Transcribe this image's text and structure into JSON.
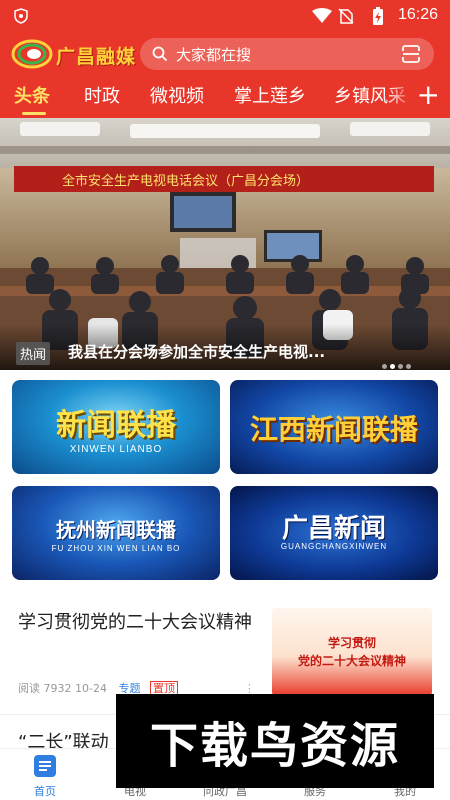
{
  "status_bar": {
    "time": "16:26"
  },
  "header": {
    "logo_text": "广昌融媒",
    "search_placeholder": "大家都在搜"
  },
  "tabs": [
    {
      "label": "头条",
      "active": true
    },
    {
      "label": "时政",
      "active": false
    },
    {
      "label": "微视频",
      "active": false
    },
    {
      "label": "掌上莲乡",
      "active": false
    },
    {
      "label": "乡镇风采",
      "active": false
    }
  ],
  "hero": {
    "banner_text": "全市安全生产电视电话会议（广昌分会场）",
    "tag": "热闻",
    "caption": "我县在分会场参加全市安全生产电视...",
    "slide_count": 4,
    "active_slide": 1
  },
  "cards": [
    {
      "title": "新闻联播",
      "subtitle": "XINWEN LIANBO"
    },
    {
      "title": "江西新闻联播",
      "subtitle": ""
    },
    {
      "title": "抚州新闻联播",
      "subtitle": "FU ZHOU XIN WEN LIAN BO"
    },
    {
      "title": "广昌新闻",
      "subtitle": "GUANGCHANGXINWEN"
    }
  ],
  "news": [
    {
      "title": "学习贯彻党的二十大会议精神",
      "reads": "阅读 7932",
      "date": "10-24",
      "topic": "专题",
      "pin": "置顶",
      "thumb_line1": "学习贯彻",
      "thumb_line2": "党的二十大会议精神"
    }
  ],
  "news2_title": "“二长”联动",
  "bottom_nav": [
    {
      "label": "首页",
      "active": true
    },
    {
      "label": "电视",
      "active": false
    },
    {
      "label": "问政广昌",
      "active": false
    },
    {
      "label": "服务",
      "active": false
    },
    {
      "label": "我的",
      "active": false
    }
  ],
  "watermark": "下载鸟资源",
  "colors": {
    "brand_red": "#e8372a",
    "tab_active": "#ffe066",
    "nav_active": "#2f7fe0"
  }
}
